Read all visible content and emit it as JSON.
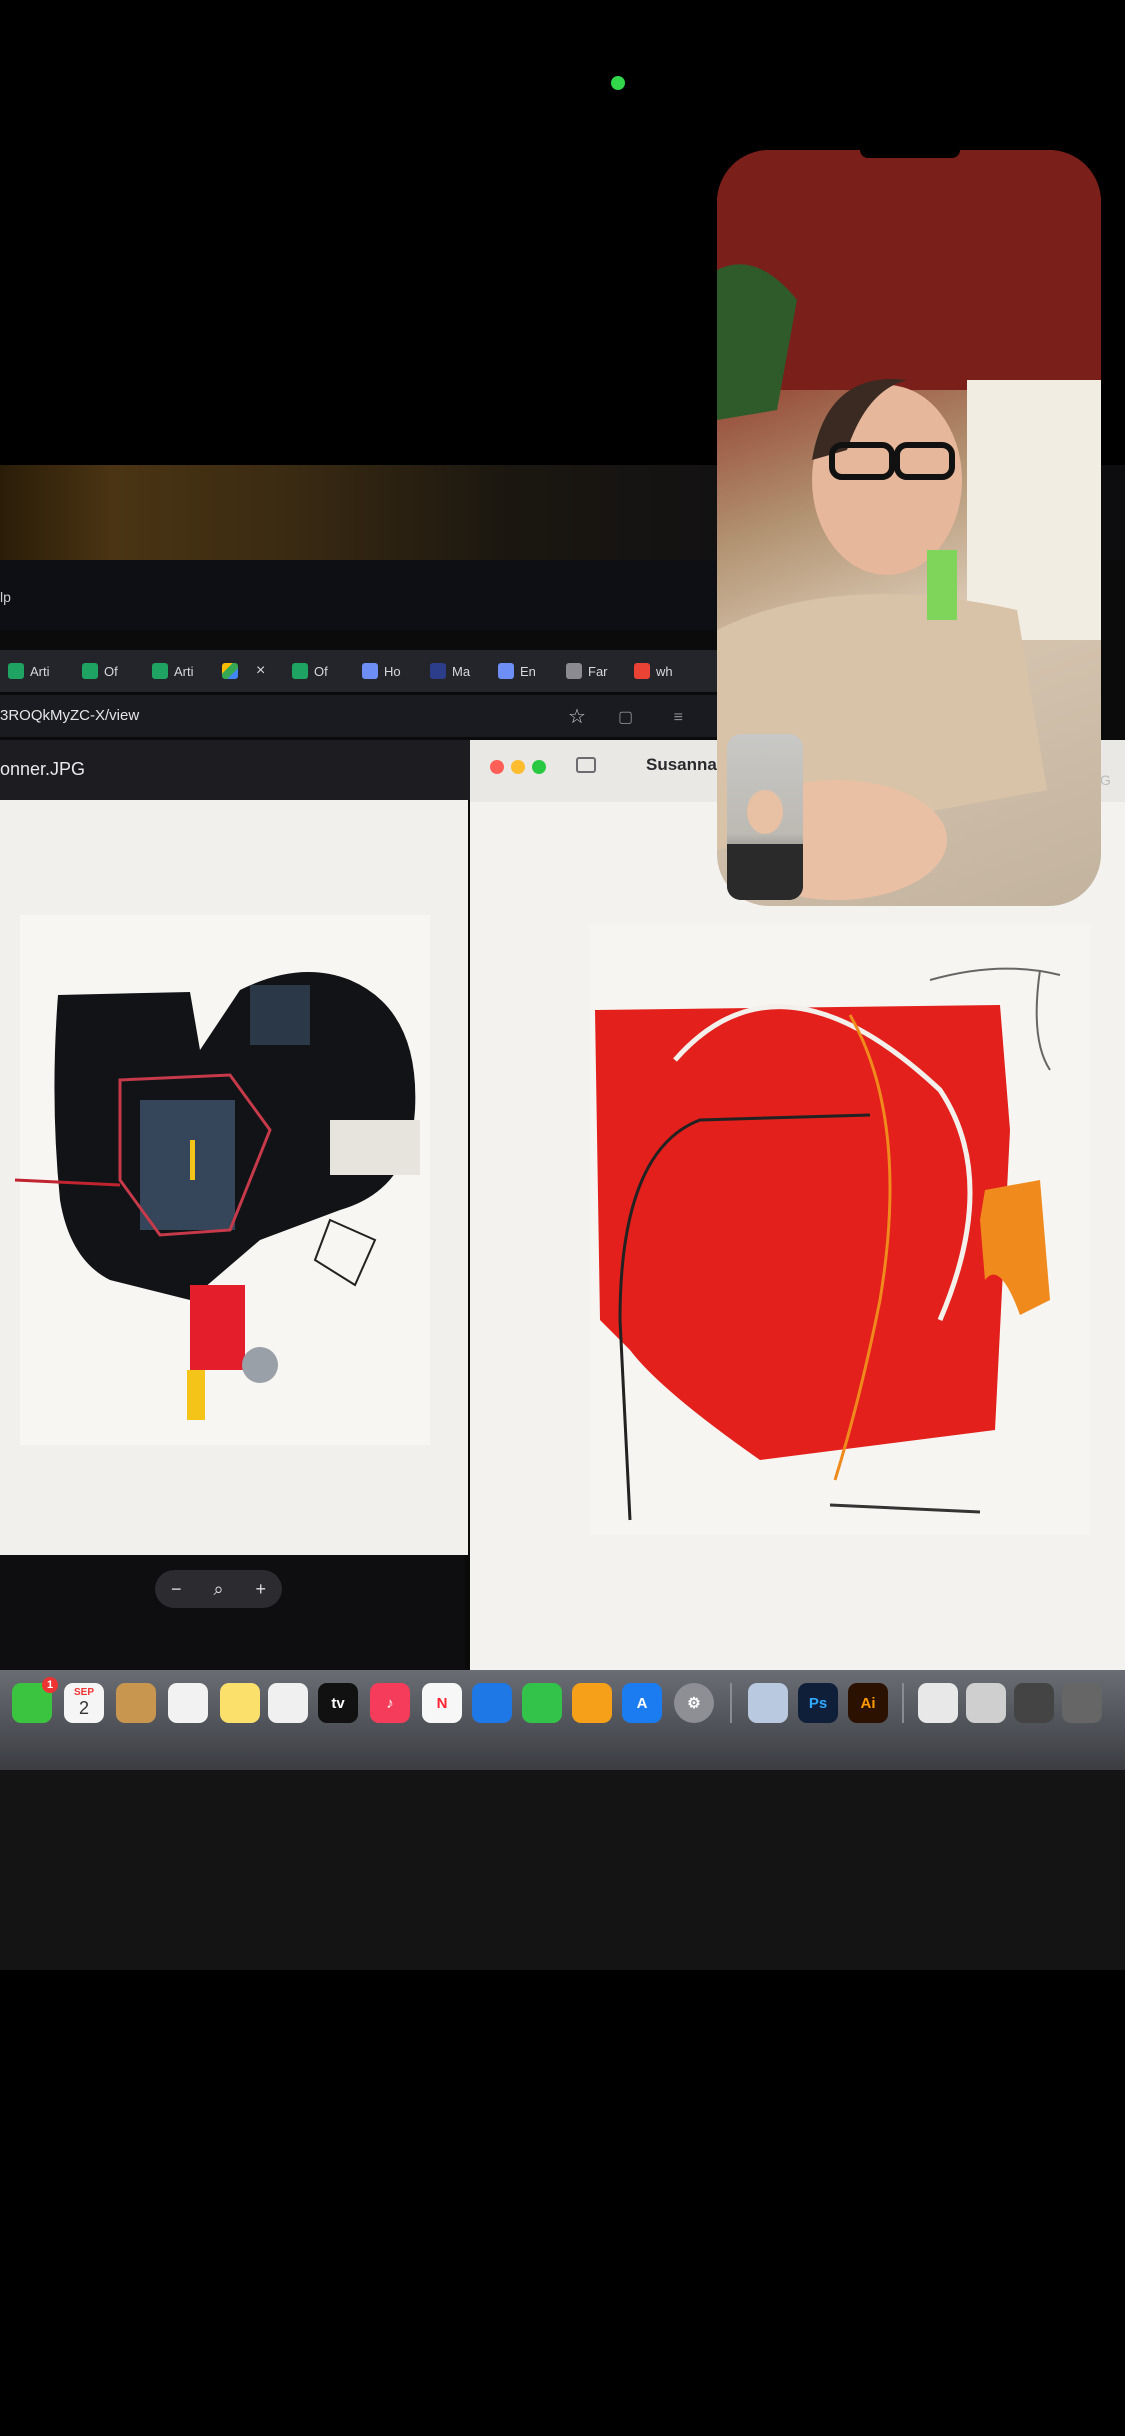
{
  "status": {
    "camera_indicator": "green"
  },
  "browser": {
    "menu_partial": "lp",
    "tabs": [
      {
        "label": "Arti",
        "icon": "sheets-icon"
      },
      {
        "label": "Of",
        "icon": "sheets-icon"
      },
      {
        "label": "Arti",
        "icon": "sheets-icon"
      },
      {
        "label": "",
        "icon": "drive-icon",
        "active": true,
        "close": "×"
      },
      {
        "label": "Of",
        "icon": "sheets-icon"
      },
      {
        "label": "Ho",
        "icon": "globe-icon"
      },
      {
        "label": "Ma",
        "icon": "slash-icon"
      },
      {
        "label": "En",
        "icon": "ca-icon"
      },
      {
        "label": "Far",
        "icon": "globe-icon"
      },
      {
        "label": "wh",
        "icon": "google-icon"
      }
    ],
    "url": "3ROQkMyZC-X/view",
    "star": "☆"
  },
  "viewer": {
    "title": "onner.JPG",
    "zoom_out": "−",
    "zoom_icon": "⌕",
    "zoom_in": "+"
  },
  "safari": {
    "title": "Susannal",
    "right_partial": "G"
  },
  "dock": {
    "calendar_month": "SEP",
    "calendar_day": "2",
    "facetime_badge": "1",
    "tv_label": "tv",
    "ps_label": "Ps",
    "ai_label": "Ai"
  },
  "colors": {
    "red_art": "#e3201b",
    "orange_art": "#f08a1c",
    "accent_green": "#32d74b"
  }
}
